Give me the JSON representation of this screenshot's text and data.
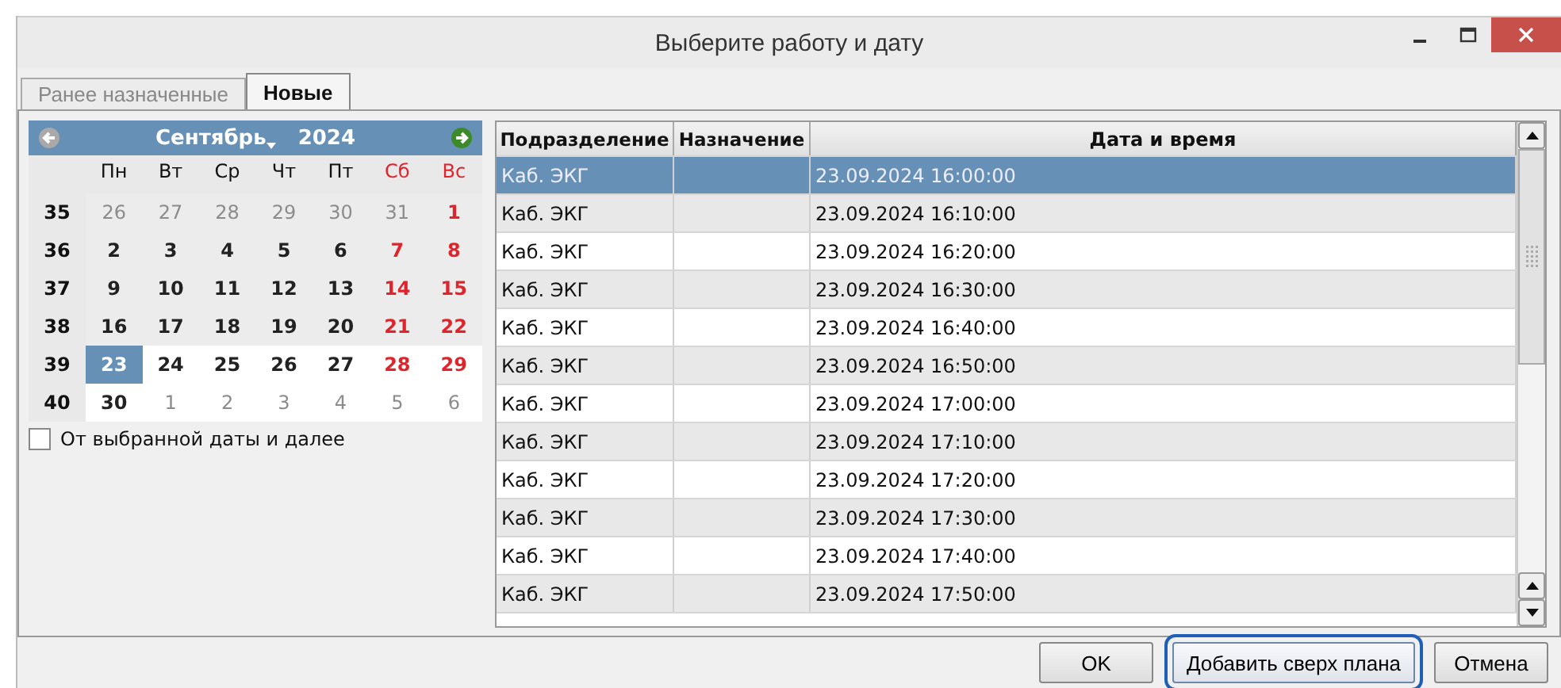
{
  "window": {
    "title": "Выберите работу и дату"
  },
  "tabs": [
    {
      "label": "Ранее назначенные",
      "selected": false
    },
    {
      "label": "Новые",
      "selected": true
    }
  ],
  "calendar": {
    "month": "Сентябрь",
    "year": "2024",
    "weekdays": [
      {
        "label": "Пн",
        "weekend": false
      },
      {
        "label": "Вт",
        "weekend": false
      },
      {
        "label": "Ср",
        "weekend": false
      },
      {
        "label": "Чт",
        "weekend": false
      },
      {
        "label": "Пт",
        "weekend": false
      },
      {
        "label": "Сб",
        "weekend": true
      },
      {
        "label": "Вс",
        "weekend": true
      }
    ],
    "weeks": [
      {
        "number": "35",
        "available": false,
        "days": [
          {
            "label": "26",
            "muted": true,
            "weekend": false,
            "selected": false
          },
          {
            "label": "27",
            "muted": true,
            "weekend": false,
            "selected": false
          },
          {
            "label": "28",
            "muted": true,
            "weekend": false,
            "selected": false
          },
          {
            "label": "29",
            "muted": true,
            "weekend": false,
            "selected": false
          },
          {
            "label": "30",
            "muted": true,
            "weekend": false,
            "selected": false
          },
          {
            "label": "31",
            "muted": true,
            "weekend": true,
            "selected": false
          },
          {
            "label": "1",
            "muted": false,
            "weekend": true,
            "selected": false
          }
        ]
      },
      {
        "number": "36",
        "available": false,
        "days": [
          {
            "label": "2",
            "muted": false,
            "weekend": false,
            "selected": false
          },
          {
            "label": "3",
            "muted": false,
            "weekend": false,
            "selected": false
          },
          {
            "label": "4",
            "muted": false,
            "weekend": false,
            "selected": false
          },
          {
            "label": "5",
            "muted": false,
            "weekend": false,
            "selected": false
          },
          {
            "label": "6",
            "muted": false,
            "weekend": false,
            "selected": false
          },
          {
            "label": "7",
            "muted": false,
            "weekend": true,
            "selected": false
          },
          {
            "label": "8",
            "muted": false,
            "weekend": true,
            "selected": false
          }
        ]
      },
      {
        "number": "37",
        "available": false,
        "days": [
          {
            "label": "9",
            "muted": false,
            "weekend": false,
            "selected": false
          },
          {
            "label": "10",
            "muted": false,
            "weekend": false,
            "selected": false
          },
          {
            "label": "11",
            "muted": false,
            "weekend": false,
            "selected": false
          },
          {
            "label": "12",
            "muted": false,
            "weekend": false,
            "selected": false
          },
          {
            "label": "13",
            "muted": false,
            "weekend": false,
            "selected": false
          },
          {
            "label": "14",
            "muted": false,
            "weekend": true,
            "selected": false
          },
          {
            "label": "15",
            "muted": false,
            "weekend": true,
            "selected": false
          }
        ]
      },
      {
        "number": "38",
        "available": false,
        "days": [
          {
            "label": "16",
            "muted": false,
            "weekend": false,
            "selected": false
          },
          {
            "label": "17",
            "muted": false,
            "weekend": false,
            "selected": false
          },
          {
            "label": "18",
            "muted": false,
            "weekend": false,
            "selected": false
          },
          {
            "label": "19",
            "muted": false,
            "weekend": false,
            "selected": false
          },
          {
            "label": "20",
            "muted": false,
            "weekend": false,
            "selected": false
          },
          {
            "label": "21",
            "muted": false,
            "weekend": true,
            "selected": false
          },
          {
            "label": "22",
            "muted": false,
            "weekend": true,
            "selected": false
          }
        ]
      },
      {
        "number": "39",
        "available": true,
        "days": [
          {
            "label": "23",
            "muted": false,
            "weekend": false,
            "selected": true
          },
          {
            "label": "24",
            "muted": false,
            "weekend": false,
            "selected": false
          },
          {
            "label": "25",
            "muted": false,
            "weekend": false,
            "selected": false
          },
          {
            "label": "26",
            "muted": false,
            "weekend": false,
            "selected": false
          },
          {
            "label": "27",
            "muted": false,
            "weekend": false,
            "selected": false
          },
          {
            "label": "28",
            "muted": false,
            "weekend": true,
            "selected": false
          },
          {
            "label": "29",
            "muted": false,
            "weekend": true,
            "selected": false
          }
        ]
      },
      {
        "number": "40",
        "available": true,
        "days": [
          {
            "label": "30",
            "muted": false,
            "weekend": false,
            "selected": false
          },
          {
            "label": "1",
            "muted": true,
            "weekend": false,
            "selected": false
          },
          {
            "label": "2",
            "muted": true,
            "weekend": false,
            "selected": false
          },
          {
            "label": "3",
            "muted": true,
            "weekend": false,
            "selected": false
          },
          {
            "label": "4",
            "muted": true,
            "weekend": false,
            "selected": false
          },
          {
            "label": "5",
            "muted": true,
            "weekend": true,
            "selected": false
          },
          {
            "label": "6",
            "muted": true,
            "weekend": true,
            "selected": false
          }
        ]
      }
    ]
  },
  "from_date_checkbox": {
    "label": "От выбранной даты и далее",
    "checked": false
  },
  "table": {
    "columns": [
      "Подразделение",
      "Назначение",
      "Дата и время"
    ],
    "rows": [
      {
        "department": "Каб. ЭКГ",
        "datetime": "23.09.2024 16:00:00",
        "selected": true
      },
      {
        "department": "Каб. ЭКГ",
        "datetime": "23.09.2024 16:10:00",
        "selected": false
      },
      {
        "department": "Каб. ЭКГ",
        "datetime": "23.09.2024 16:20:00",
        "selected": false
      },
      {
        "department": "Каб. ЭКГ",
        "datetime": "23.09.2024 16:30:00",
        "selected": false
      },
      {
        "department": "Каб. ЭКГ",
        "datetime": "23.09.2024 16:40:00",
        "selected": false
      },
      {
        "department": "Каб. ЭКГ",
        "datetime": "23.09.2024 16:50:00",
        "selected": false
      },
      {
        "department": "Каб. ЭКГ",
        "datetime": "23.09.2024 17:00:00",
        "selected": false
      },
      {
        "department": "Каб. ЭКГ",
        "datetime": "23.09.2024 17:10:00",
        "selected": false
      },
      {
        "department": "Каб. ЭКГ",
        "datetime": "23.09.2024 17:20:00",
        "selected": false
      },
      {
        "department": "Каб. ЭКГ",
        "datetime": "23.09.2024 17:30:00",
        "selected": false
      },
      {
        "department": "Каб. ЭКГ",
        "datetime": "23.09.2024 17:40:00",
        "selected": false
      },
      {
        "department": "Каб. ЭКГ",
        "datetime": "23.09.2024 17:50:00",
        "selected": false
      }
    ]
  },
  "buttons": [
    {
      "label": "OK",
      "focused": false
    },
    {
      "label": "Добавить сверх плана",
      "focused": true
    },
    {
      "label": "Отмена",
      "focused": false
    }
  ]
}
